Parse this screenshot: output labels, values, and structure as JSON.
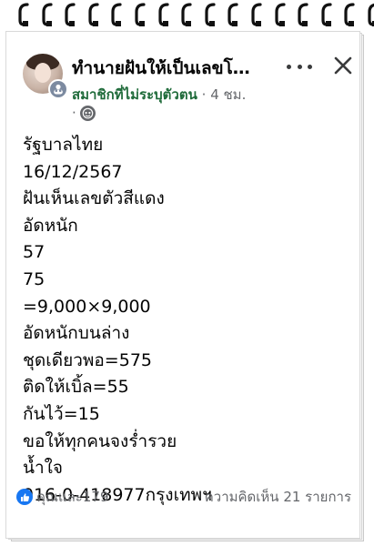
{
  "post": {
    "group_name": "ทำนายฝันให้เป็นเลขโ…",
    "author": "สมาชิกที่ไม่ระบุตัวตน",
    "separator": "·",
    "time": "4 ชม.",
    "audience_separator": "·",
    "audience_icon": "globe-icon",
    "body_lines": [
      "รัฐบาลไทย",
      "16/12/2567",
      "ฝันเห็นเลขตัวสีแดง",
      "อัดหนัก",
      "57",
      "75",
      "=9,000×9,000",
      "อัดหนักบนล่าง",
      "ชุดเดียวพอ=575",
      "ติดให้เบิ้ล=55",
      "กันไว้=15",
      "ขอให้ทุกคนจงร่ำรวย",
      "น้ำใจ",
      "916-0-418977กรุงเทพฯ"
    ]
  },
  "footer": {
    "reactions_text": "คุณและ179",
    "comments_text": "ความคิดเห็น 21 รายการ"
  },
  "icons": {
    "more": "more-options-icon",
    "close": "close-icon",
    "like": "like-icon",
    "anonymous": "anonymous-badge-icon"
  },
  "colors": {
    "author": "#1f6b3a",
    "muted": "#65676b",
    "like_blue": "#1877f2",
    "text": "#050505"
  }
}
